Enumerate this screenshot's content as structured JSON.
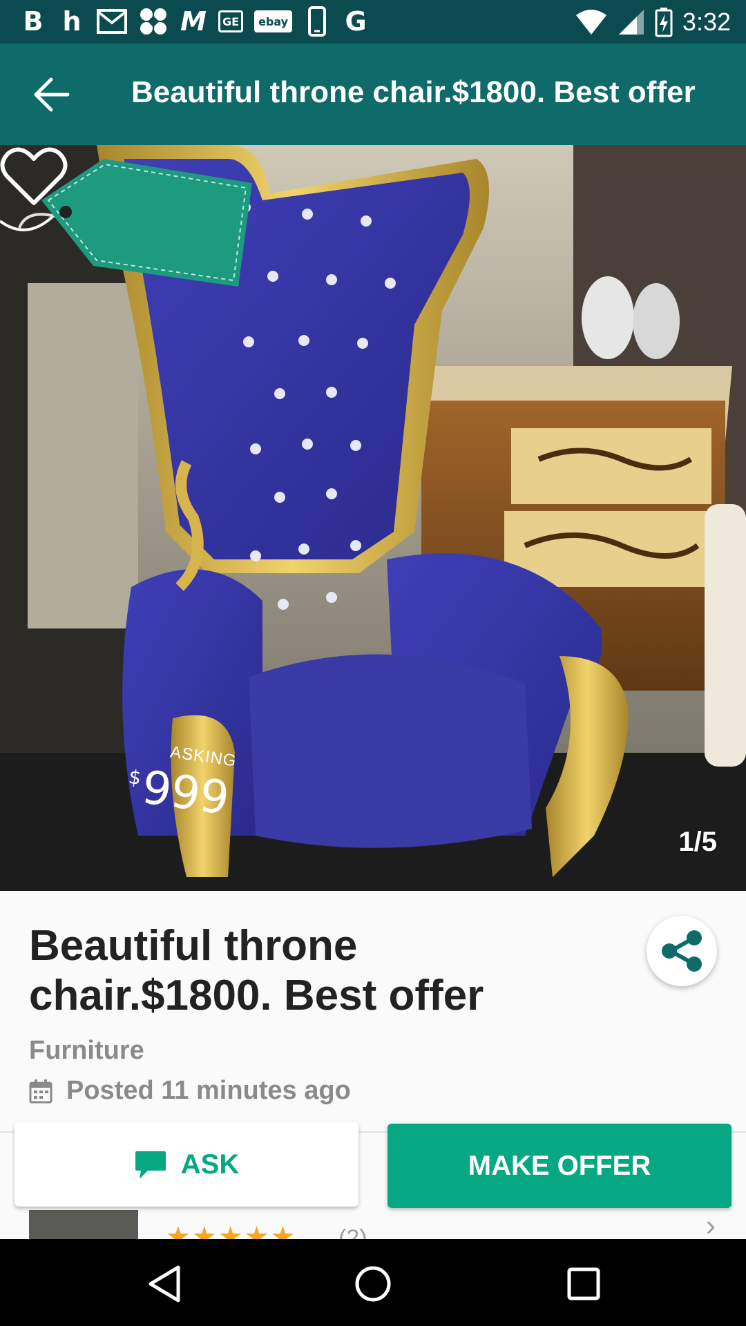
{
  "status_bar": {
    "time": "3:32",
    "notification_icons": [
      "b-icon",
      "h-icon",
      "mail-icon",
      "asterisk-icon",
      "m-icon",
      "ge-icon",
      "ebay-icon",
      "phone-icon",
      "google-icon"
    ],
    "ge_label": "GE",
    "ebay_label": "ebay"
  },
  "app_bar": {
    "title": "Beautiful throne chair.$1800. Best offer",
    "back_icon": "arrow-left-icon"
  },
  "photo": {
    "counter": "1/5",
    "favorite_icon": "heart-outline-icon",
    "price_tag": {
      "label": "ASKING",
      "currency": "$",
      "amount": "999"
    }
  },
  "listing": {
    "title": "Beautiful throne chair.$1800. Best offer",
    "category": "Furniture",
    "posted": "Posted 11 minutes ago",
    "share_icon": "share-icon",
    "calendar_icon": "calendar-icon"
  },
  "seller_peek": {
    "stars": "★★★★★",
    "review_count": "(2)"
  },
  "actions": {
    "ask_label": "ASK",
    "offer_label": "MAKE OFFER"
  },
  "colors": {
    "status_bar": "#0b4a4f",
    "app_bar": "#0e6b6a",
    "accent": "#05a882",
    "star": "#f6a623"
  }
}
